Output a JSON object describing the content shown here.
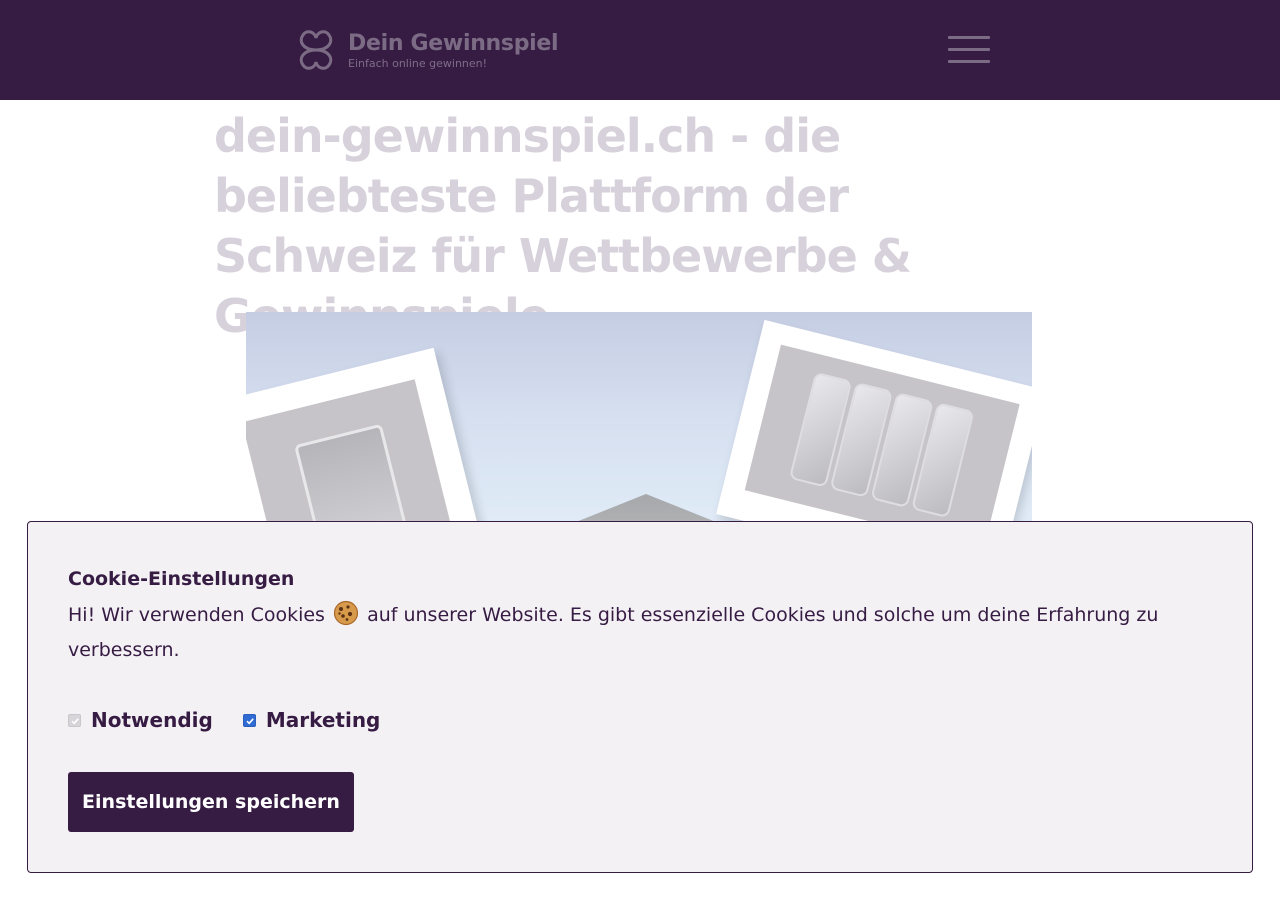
{
  "header": {
    "logo_title": "Dein Gewinnspiel",
    "logo_subtitle": "Einfach online gewinnen!",
    "menu_icon": "hamburger-menu-icon"
  },
  "hero": {
    "title": "dein-gewinnspiel.ch - die beliebteste Plattform der Schweiz für Wettbewerbe & Gewinnspiele"
  },
  "cookie_banner": {
    "title": "Cookie-Einstellungen",
    "text_before_emoji": "Hi! Wir verwenden Cookies",
    "text_after_emoji": "auf unserer Website. Es gibt essenzielle Cookies und solche um deine Erfahrung zu verbessern.",
    "emoji_icon": "cookie-icon",
    "options": [
      {
        "label": "Notwendig",
        "checked": true,
        "disabled": true
      },
      {
        "label": "Marketing",
        "checked": true,
        "disabled": false
      }
    ],
    "save_button": "Einstellungen speichern"
  },
  "colors": {
    "brand_purple": "#361b43",
    "panel_bg": "#f4f1f5",
    "checkbox_blue": "#2f6bd3"
  }
}
